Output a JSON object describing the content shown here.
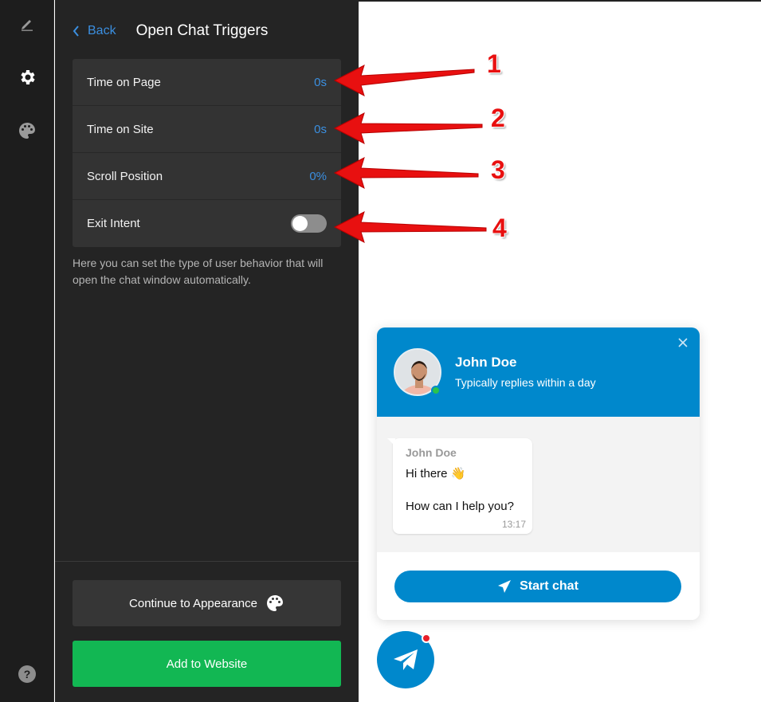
{
  "sidebar": {
    "icons": [
      "edit-icon",
      "gear-icon",
      "palette-icon",
      "help-icon"
    ]
  },
  "panel": {
    "back_label": "Back",
    "title": "Open Chat Triggers",
    "triggers": [
      {
        "label": "Time on Page",
        "value": "0s"
      },
      {
        "label": "Time on Site",
        "value": "0s"
      },
      {
        "label": "Scroll Position",
        "value": "0%"
      },
      {
        "label": "Exit Intent",
        "value": "off"
      }
    ],
    "hint": "Here you can set the type of user behavior that will open the chat window automatically.",
    "continue_label": "Continue to Appearance",
    "add_label": "Add to Website"
  },
  "annotations": [
    "1",
    "2",
    "3",
    "4"
  ],
  "widget": {
    "name": "John Doe",
    "subtitle": "Typically replies within a day",
    "message_sender": "John Doe",
    "message_line1": "Hi there 👋",
    "message_line2": "How can I help you?",
    "message_time": "13:17",
    "start_label": "Start chat"
  },
  "colors": {
    "accent": "#3b8fe0",
    "widget_blue": "#0088cc",
    "add_green": "#12b753",
    "arrow_red": "#e81010"
  }
}
